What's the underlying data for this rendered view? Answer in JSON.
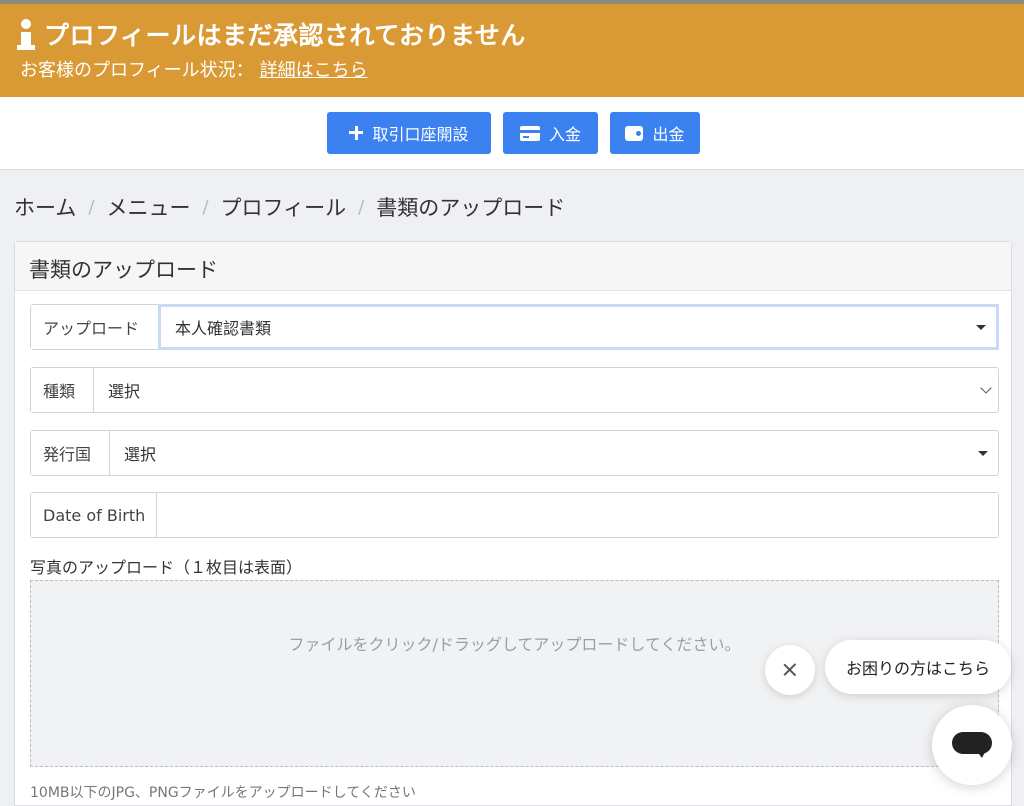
{
  "banner": {
    "title": "プロフィールはまだ承認されておりません",
    "status_label": "お客様のプロフィール状況：",
    "details_link": "詳細はこちら",
    "color": "#d99a36"
  },
  "toolbar": {
    "open_account_label": "取引口座開設",
    "deposit_label": "入金",
    "withdraw_label": "出金",
    "accent_color": "#3b82f0"
  },
  "breadcrumb": {
    "items": [
      "ホーム",
      "メニュー",
      "プロフィール",
      "書類のアップロード"
    ],
    "separator": "/"
  },
  "panel": {
    "title": "書類のアップロード",
    "fields": {
      "upload": {
        "label": "アップロード",
        "value": "本人確認書類"
      },
      "type": {
        "label": "種類",
        "value": "選択"
      },
      "country": {
        "label": "発行国",
        "value": "選択"
      },
      "dob": {
        "label": "Date of Birth",
        "value": ""
      }
    },
    "photo_label": "写真のアップロード（１枚目は表面）",
    "dropzone_message": "ファイルをクリック/ドラッグしてアップロードしてください。",
    "hint": "10MB以下のJPG、PNGファイルをアップロードしてください"
  },
  "chat": {
    "help_text": "お困りの方はこちら",
    "icons": [
      "close-icon",
      "chat-icon"
    ]
  }
}
